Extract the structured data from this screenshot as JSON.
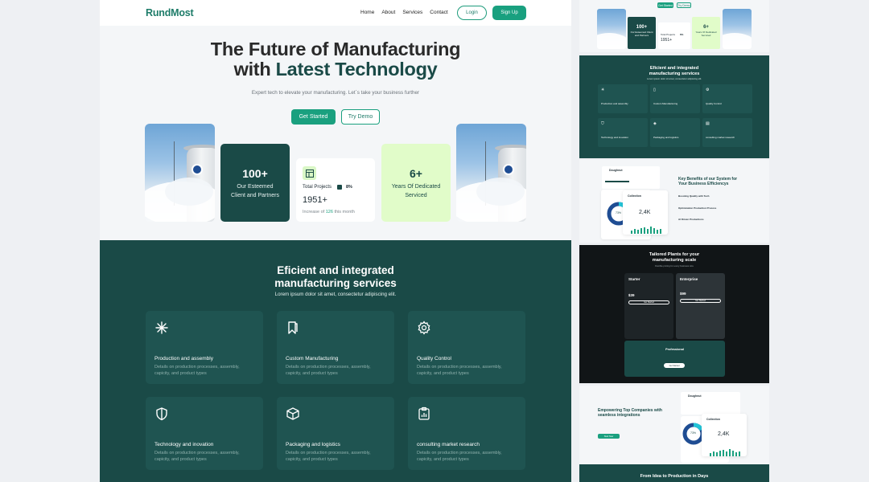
{
  "nav": {
    "logo": "RundMost",
    "links": [
      "Home",
      "About",
      "Services",
      "Contact"
    ],
    "login": "Login",
    "signup": "Sign Up"
  },
  "hero": {
    "title_line1": "The Future of Manufacturing",
    "title_line2_plain": "with ",
    "title_line2_accent": "Latest Technology",
    "subtitle": "Expert tech to elevate your manufacturing. Let`s take your business further",
    "primary_button": "Get Started",
    "secondary_button": "Try Demo"
  },
  "stats": {
    "clients": {
      "value": "100+",
      "label_line1": "Our Esteemed",
      "label_line2": "Client and Partners"
    },
    "projects": {
      "label": "Total Projects",
      "percent": "8%",
      "value": "1951+",
      "increase_prefix": "Increase of ",
      "increase_value": "126",
      "increase_suffix": " this month"
    },
    "years": {
      "value": "6+",
      "label_line1": "Years Of Dedicated",
      "label_line2": "Serviced"
    }
  },
  "services": {
    "title_line1": "Eficient and integrated",
    "title_line2": "manufacturing services",
    "subtitle": "Lorem ipsum dolor sit amet, consectetur adipiscing elit.",
    "items": [
      {
        "title": "Production and assembly",
        "desc": "Details on production processes, assembly, capicity, and product types",
        "icon": "sparkle-icon"
      },
      {
        "title": "Custom Manufacturing",
        "desc": "Details on production processes, assembly, capicity, and product types",
        "icon": "bookmark-icon"
      },
      {
        "title": "Quality Control",
        "desc": "Details on production processes, assembly, capicity, and product types",
        "icon": "gear-icon"
      },
      {
        "title": "Technology and inovation",
        "desc": "Details on production processes, assembly, capicity, and product types",
        "icon": "shield-icon"
      },
      {
        "title": "Packaging and logistics",
        "desc": "Details on production processes, assembly, capicity, and product types",
        "icon": "box-icon"
      },
      {
        "title": "consulting market research",
        "desc": "Details on production processes, assembly, capicity, and product types",
        "icon": "clipboard-chart-icon"
      }
    ]
  },
  "thumbs": {
    "hero": {
      "btn1": "Get Started",
      "btn2": "Try Demo",
      "clients": "100+",
      "clients_label": "Our Esteemed Client and Partners",
      "projects_label": "Total Projects",
      "projects_pct": "8%",
      "projects_value": "1951+",
      "years": "6+",
      "years_label": "Years Of Dedicated Serviced"
    },
    "services": {
      "title_line1": "Eficient and integrated",
      "title_line2": "manufacturing services",
      "subtitle": "Lorem ipsum dolor sit amet, consectetur adipiscing elit.",
      "items": [
        "Production and assembly",
        "Custom Manufacturing",
        "Quality Control",
        "Technology and inovation",
        "Packaging and logistics",
        "consulting market research"
      ]
    },
    "benefits": {
      "brand": "Doughnut",
      "title_line1": "Key Benefits of our System for",
      "title_line2": "Your Business Efficiencys",
      "collection": "Collection",
      "donut_pct": "73%",
      "big_value": "2,4K",
      "list": [
        "Boosting Quality with Tech",
        "Optimization Production Process",
        "AI Driven Productions"
      ]
    },
    "plans": {
      "title_line1": "Tailored Plants for your",
      "title_line2": "manufacturing scale",
      "subtitle": "Flexible pricing for every business size",
      "starter": {
        "name": "Starter",
        "price": "$39",
        "button": "Get Started"
      },
      "enterprise": {
        "name": "Enterprise",
        "price": "$99",
        "button": "Get Started"
      },
      "professional": {
        "name": "Professional",
        "button": "Get Started"
      }
    },
    "integrations": {
      "title_line1": "Empowering Top Companies with",
      "title_line2": "seamless integrations",
      "button": "Start Now",
      "brand": "Doughnut",
      "collection": "Collection",
      "donut_pct": "73%",
      "big_value": "2,4K"
    },
    "idea": {
      "title": "From Idea to Production in Days"
    }
  },
  "colors": {
    "brand_dark": "#1a4a47",
    "brand_green": "#1aa07f",
    "lime": "#e1fcc9",
    "plans_bg": "#111517"
  }
}
